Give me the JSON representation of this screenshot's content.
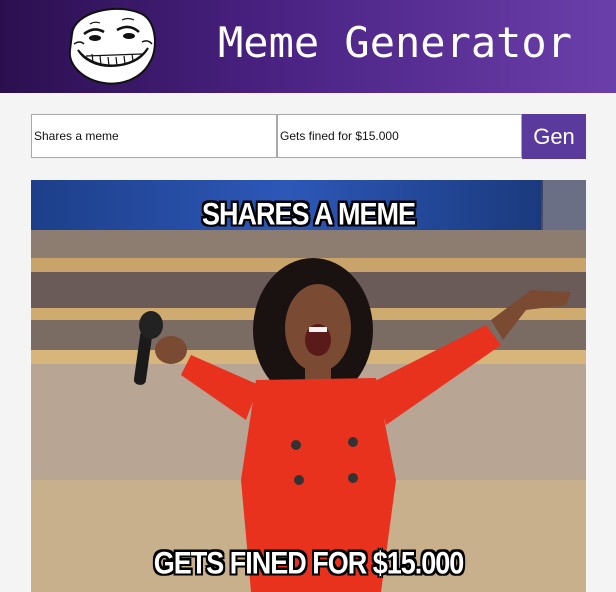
{
  "header": {
    "title": "Meme Generator",
    "logo_icon": "trollface-icon",
    "gradient_colors": [
      "#2b0f4f",
      "#6b3faa"
    ]
  },
  "form": {
    "top_text_value": "Shares a meme",
    "bottom_text_value": "Gets fined for $15.000",
    "generate_label": "Gen",
    "button_color": "#5b3a9e"
  },
  "meme": {
    "top_caption": "SHARES A MEME",
    "bottom_caption": "GETS FINED FOR $15.000"
  }
}
